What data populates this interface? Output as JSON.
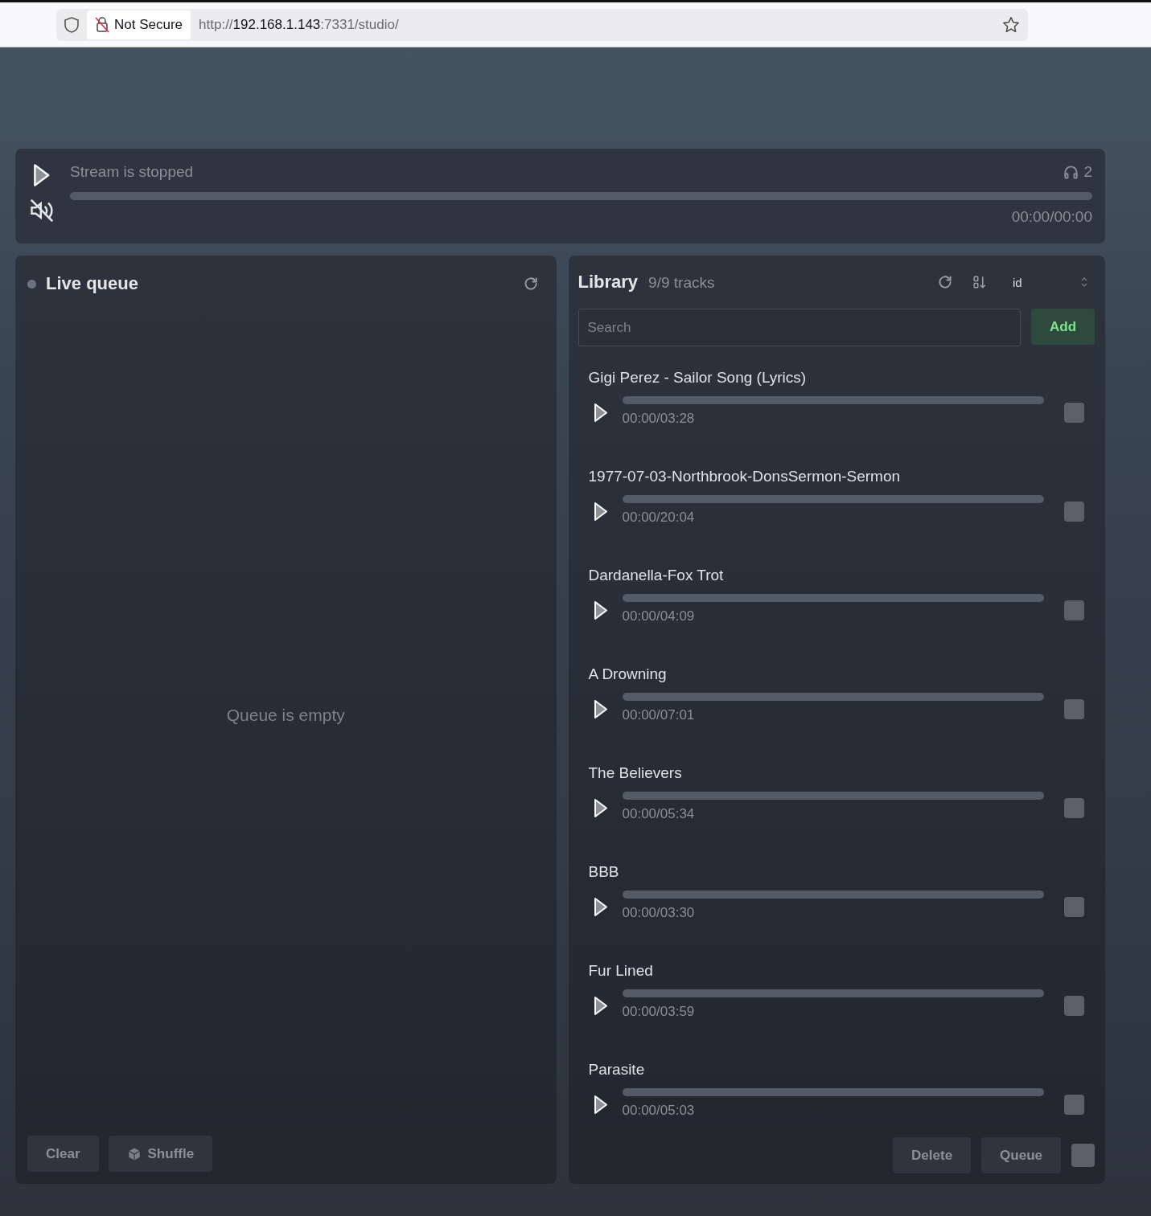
{
  "browser": {
    "security": "Not Secure",
    "url": {
      "scheme": "http://",
      "host": "192.168.1.143",
      "rest": ":7331/studio/"
    }
  },
  "player": {
    "status": "Stream is stopped",
    "listeners": "2",
    "level": 0,
    "time": "00:00/00:00",
    "muted": true,
    "playing": false
  },
  "queue": {
    "title": "Live queue",
    "live": false,
    "empty_text": "Queue is empty",
    "buttons": [
      {
        "label": "Clear",
        "kind": "plain"
      },
      {
        "label": "Shuffle",
        "kind": "dice"
      }
    ]
  },
  "library": {
    "title": "Library",
    "count": "9/9 tracks",
    "sort": "id",
    "search": {
      "placeholder": "Search"
    },
    "add_button": "Add",
    "tracks": [
      {
        "title": "Gigi Perez - Sailor Song (Lyrics)",
        "time": "00:00/03:28",
        "level": 0,
        "checked": false
      },
      {
        "title": "1977-07-03-Northbrook-DonsSermon-Sermon",
        "time": "00:00/20:04",
        "level": 0,
        "checked": false
      },
      {
        "title": "Dardanella-Fox Trot",
        "time": "00:00/04:09",
        "level": 0,
        "checked": false
      },
      {
        "title": "A Drowning",
        "time": "00:00/07:01",
        "level": 0,
        "checked": false
      },
      {
        "title": "The Believers",
        "time": "00:00/05:34",
        "level": 0,
        "checked": false
      },
      {
        "title": "BBB",
        "time": "00:00/03:30",
        "level": 0,
        "checked": false
      },
      {
        "title": "Fur Lined",
        "time": "00:00/03:59",
        "level": 0,
        "checked": false
      },
      {
        "title": "Parasite",
        "time": "00:00/05:03",
        "level": 0,
        "checked": false
      }
    ],
    "footer_buttons": [
      "Delete",
      "Queue"
    ],
    "select_all": false
  }
}
